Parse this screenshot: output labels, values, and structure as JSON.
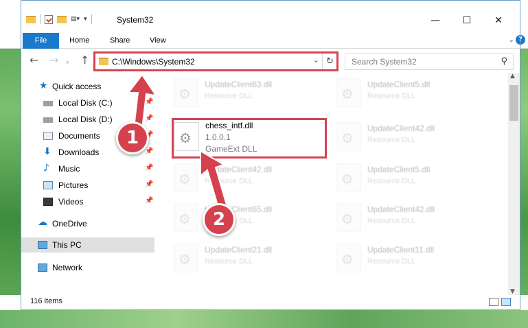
{
  "window": {
    "title": "System32",
    "minimize": "—",
    "maximize": "☐",
    "close": "✕"
  },
  "ribbon": {
    "tabs": [
      {
        "label": "File"
      },
      {
        "label": "Home"
      },
      {
        "label": "Share"
      },
      {
        "label": "View"
      }
    ]
  },
  "nav": {
    "back": "←",
    "forward": "→",
    "up": "↑",
    "address_path": "C:\\Windows\\System32",
    "search_placeholder": "Search System32"
  },
  "sidebar": {
    "items": [
      {
        "label": "Quick access"
      },
      {
        "label": "Local Disk (C:)"
      },
      {
        "label": "Local Disk (D:)"
      },
      {
        "label": "Documents"
      },
      {
        "label": "Downloads"
      },
      {
        "label": "Music"
      },
      {
        "label": "Pictures"
      },
      {
        "label": "Videos"
      },
      {
        "label": "OneDrive"
      },
      {
        "label": "This PC"
      },
      {
        "label": "Network"
      }
    ]
  },
  "files": {
    "left": [
      {
        "name": "UpdateClient63.dll",
        "sub": "Resource DLL"
      },
      {
        "name": "chess_intf.dll",
        "version": "1.0.0.1",
        "sub": "GameExt DLL"
      },
      {
        "name": "UpdateClient42.dll",
        "sub": "Resource DLL"
      },
      {
        "name": "UpdateClient65.dll",
        "sub": "Resource DLL"
      },
      {
        "name": "UpdateClient21.dll",
        "sub": "Resource DLL"
      }
    ],
    "right": [
      {
        "name": "UpdateClient5.dll",
        "sub": "Resource DLL"
      },
      {
        "name": "UpdateClient42.dll",
        "sub": "Resource DLL"
      },
      {
        "name": "UpdateClient5.dll",
        "sub": "Resource DLL"
      },
      {
        "name": "UpdateClient42.dll",
        "sub": "Resource DLL"
      },
      {
        "name": "UpdateClient11.dll",
        "sub": "Resource DLL"
      }
    ]
  },
  "status": {
    "item_count": "116 items"
  },
  "annotations": {
    "step1": "1",
    "step2": "2",
    "color": "#d5414c"
  }
}
